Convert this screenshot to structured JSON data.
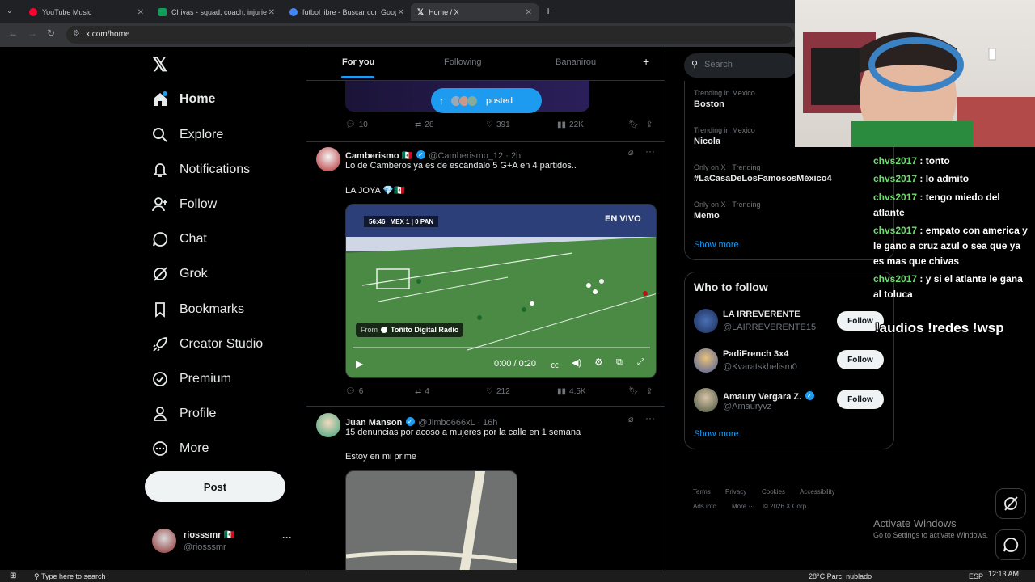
{
  "browser": {
    "tabs": [
      {
        "title": "YouTube Music",
        "color": "#ff0033"
      },
      {
        "title": "Chivas - squad, coach, injuries a",
        "color": "#0f9d58"
      },
      {
        "title": "futbol libre - Buscar con Googl",
        "color": "#4285f4"
      },
      {
        "title": "Home / X",
        "color": "#ffffff"
      }
    ],
    "new_tab": "+",
    "url": "x.com/home"
  },
  "nav": {
    "items": [
      {
        "label": "Home",
        "icon": "home-icon"
      },
      {
        "label": "Explore",
        "icon": "search-icon"
      },
      {
        "label": "Notifications",
        "icon": "bell-icon"
      },
      {
        "label": "Follow",
        "icon": "add-person-icon"
      },
      {
        "label": "Chat",
        "icon": "chat-icon"
      },
      {
        "label": "Grok",
        "icon": "grok-icon"
      },
      {
        "label": "Bookmarks",
        "icon": "bookmark-icon"
      },
      {
        "label": "Creator Studio",
        "icon": "rocket-icon"
      },
      {
        "label": "Premium",
        "icon": "premium-icon"
      },
      {
        "label": "Profile",
        "icon": "person-icon"
      },
      {
        "label": "More",
        "icon": "more-circle-icon"
      }
    ],
    "post_label": "Post",
    "account": {
      "name": "riosssmr 🇲🇽",
      "handle": "@riosssmr",
      "more": "···"
    }
  },
  "feed": {
    "tabs": [
      "For you",
      "Following",
      "Bananirou"
    ],
    "add_tab": "+",
    "posted_pill": "posted",
    "top_metrics": {
      "replies": "10",
      "reposts": "28",
      "likes": "391",
      "views": "22K"
    },
    "tweets": [
      {
        "name": "Camberismo 🇲🇽",
        "handle": "@Camberismo_12 · 2h",
        "text": "Lo de Camberos ya es de escándalo 5 G+A en 4 partidos..",
        "text2": "LA JOYA 💎🇲🇽",
        "video": {
          "live": "EN VIVO",
          "clock": "56:46",
          "score": "MEX 1 | 0 PAN",
          "from": "From",
          "source": "Toñito Digital Radio",
          "time": "0:00 / 0:20"
        },
        "metrics": {
          "replies": "6",
          "reposts": "4",
          "likes": "212",
          "views": "4.5K"
        }
      },
      {
        "name": "Juan Manson",
        "handle": "@Jimbo666xL · 16h",
        "text": "15 denuncias por acoso a mujeres por la calle en 1 semana",
        "text2": "Estoy en mi prime"
      }
    ]
  },
  "right": {
    "search_placeholder": "Search",
    "trends": [
      {
        "meta": "Trending in Mexico",
        "title": "Boston"
      },
      {
        "meta": "Trending in Mexico",
        "title": "Nicola"
      },
      {
        "meta": "Only on X · Trending",
        "title": "#LaCasaDeLosFamososMéxico4"
      },
      {
        "meta": "Only on X · Trending",
        "title": "Memo"
      }
    ],
    "show_more": "Show more",
    "who_to_follow_title": "Who to follow",
    "who_to_follow": [
      {
        "name": "LA IRREVERENTE",
        "handle": "@LAIRREVERENTE15",
        "button": "Follow"
      },
      {
        "name": "PadiFrench 3x4",
        "handle": "@Kvaratskhelism0",
        "button": "Follow"
      },
      {
        "name": "Amaury Vergara Z.",
        "handle": "@Amauryvz",
        "button": "Follow"
      }
    ],
    "footer": [
      "Terms",
      "Privacy",
      "Cookies",
      "Accessibility",
      "Ads info",
      "More ···",
      "© 2026 X Corp."
    ]
  },
  "overlay": {
    "chat": [
      {
        "user": "chvs2017",
        "msg": " : tonto"
      },
      {
        "user": "chvs2017",
        "msg": " : lo admito"
      },
      {
        "user": "chvs2017",
        "msg": " : tengo miedo del atlante"
      },
      {
        "user": "chvs2017",
        "msg": " : empato con america y le gano a cruz azul o sea que ya es mas que chivas"
      },
      {
        "user": "chvs2017",
        "msg": " : y si el atlante le gana al toluca"
      }
    ],
    "commands": "!audios !redes !wsp",
    "activate_title": "Activate Windows",
    "activate_sub": "Go to Settings to activate Windows."
  },
  "taskbar": {
    "search": "Type here to search",
    "weather": "28°C  Parc. nublado",
    "lang": "ESP",
    "time": "12:13 AM"
  }
}
